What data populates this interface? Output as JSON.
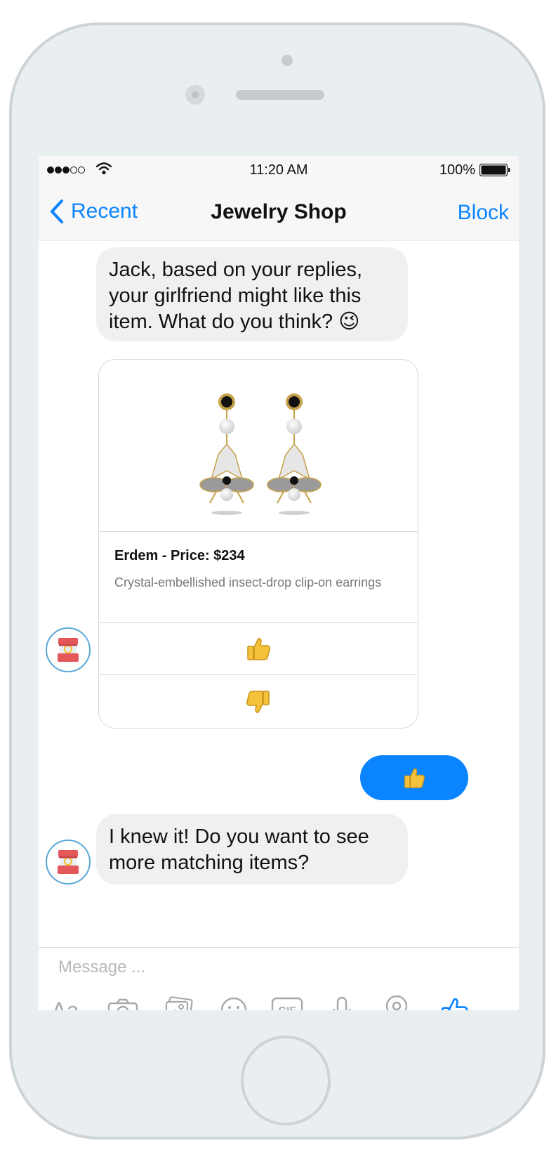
{
  "status_bar": {
    "time": "11:20 AM",
    "battery_percent": "100%",
    "signal_bars_filled": 3,
    "signal_bars_total": 5
  },
  "nav": {
    "back_label": "Recent",
    "title": "Jewelry Shop",
    "right_action": "Block"
  },
  "messages": {
    "bot_message_1": "Jack, based on your replies, your girlfriend might like this item. What do you think? 😉",
    "product_card": {
      "title": "Erdem - Price: $234",
      "description": "Crystal-embellished insect-drop clip-on earrings",
      "buttons": [
        "thumbs-up",
        "thumbs-down"
      ]
    },
    "user_reply": "thumbs-up",
    "bot_message_2": "I knew it! Do you want to see more matching items?"
  },
  "composer": {
    "placeholder": "Message ...",
    "tools": [
      "text-style-icon",
      "camera-icon",
      "gallery-icon",
      "emoji-icon",
      "gif-icon",
      "microphone-icon",
      "location-icon",
      "like-icon"
    ],
    "text_style_label": "Aa",
    "gif_label": "GIF"
  },
  "colors": {
    "accent": "#0a84ff",
    "bubble_in": "#f0f0f0",
    "phone_body": "#e9eef0",
    "phone_border": "#cdd3d6",
    "emoji_yellow": "#f6c23b"
  }
}
